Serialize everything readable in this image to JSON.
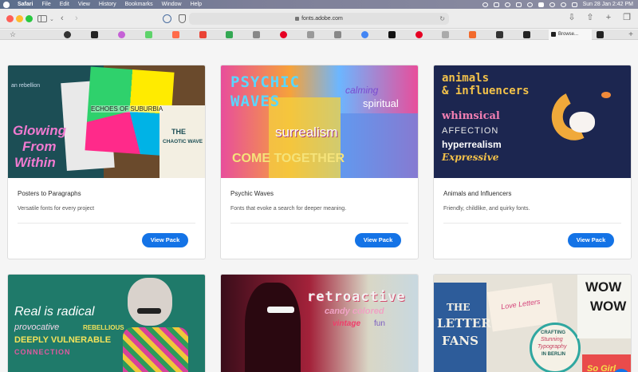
{
  "menubar": {
    "app": "Safari",
    "items": [
      "File",
      "Edit",
      "View",
      "History",
      "Bookmarks",
      "Window",
      "Help"
    ],
    "clock": "Sun 28 Jan  2:42 PM"
  },
  "toolbar": {
    "address": "fonts.adobe.com"
  },
  "tabs": {
    "active_label": "Browse..."
  },
  "cards": [
    {
      "title": "Posters to Paragraphs",
      "description": "Versatile fonts for every project",
      "button": "View Pack",
      "art": {
        "l1": "an rebellion",
        "l2": "Glowing",
        "l3": "From",
        "l4": "Within",
        "l5": "ECHOES OF SUBURBIA",
        "l6": "THE",
        "l7": "CHAOTIC WAVE"
      }
    },
    {
      "title": "Psychic Waves",
      "description": "Fonts that evoke a search for deeper meaning.",
      "button": "View Pack",
      "art": {
        "l1": "PSYCHIC",
        "l2": "WAVES",
        "l3": "calming",
        "l4": "spiritual",
        "l5": "surrealism",
        "l6": "COME TOGETHER"
      }
    },
    {
      "title": "Animals and Influencers",
      "description": "Friendly, childlike, and quirky fonts.",
      "button": "View Pack",
      "art": {
        "l1": "animals",
        "l2": "& influencers",
        "l3": "whimsical",
        "l4": "AFFECTION",
        "l5": "hyperrealism",
        "l6": "Expressive"
      }
    },
    {
      "art": {
        "l1": "Real is radical",
        "l2": "provocative",
        "l3": "REBELLIOUS",
        "l4": "DEEPLY VULNERABLE",
        "l5": "CONNECTION"
      }
    },
    {
      "art": {
        "l1": "retroactive",
        "l2": "candy colored",
        "l3": "vintage",
        "l4": "fun"
      }
    },
    {
      "art": {
        "l1": "THE",
        "l2": "LETTER",
        "l3": "FANS",
        "l4": "Love Letters",
        "l5": "CRAFTING",
        "l6": "Stunning",
        "l7": "Typography",
        "l8": "IN BERLIN",
        "l9": "WOW",
        "l10": "WOW",
        "l11": "So Girl"
      }
    }
  ]
}
